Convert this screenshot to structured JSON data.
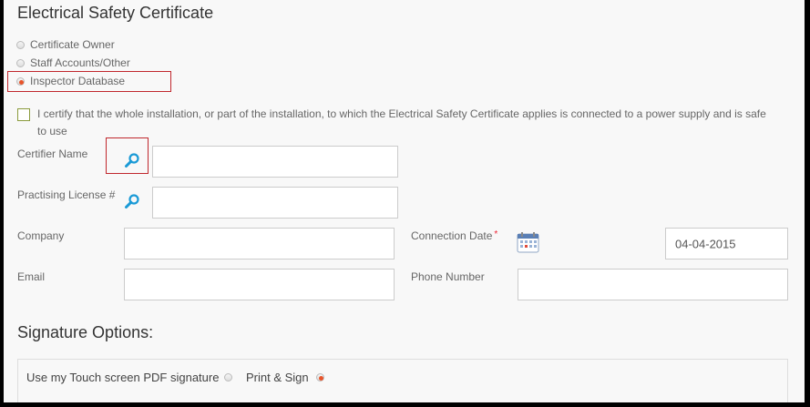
{
  "form": {
    "title": "Electrical Safety Certificate",
    "source_options": [
      {
        "label": "Certificate Owner",
        "selected": false
      },
      {
        "label": "Staff Accounts/Other",
        "selected": false
      },
      {
        "label": "Inspector Database",
        "selected": true
      }
    ],
    "certify_text": "I certify that the whole installation, or part of the installation, to which the Electrical Safety Certificate applies is connected to a power supply and is safe to use",
    "certify_checked": false,
    "fields": {
      "certifier_name": {
        "label": "Certifier Name",
        "value": ""
      },
      "practising_license": {
        "label": "Practising License #",
        "value": ""
      },
      "company": {
        "label": "Company",
        "value": ""
      },
      "connection_date": {
        "label": "Connection Date",
        "required_mark": "*",
        "value": "04-04-2015"
      },
      "email": {
        "label": "Email",
        "value": ""
      },
      "phone_number": {
        "label": "Phone Number",
        "value": ""
      }
    },
    "icons": {
      "search": "search-icon",
      "calendar": "calendar-icon"
    },
    "colors": {
      "highlight_border": "#c0272d",
      "search_icon": "#1a9ad6",
      "radio_selected": "#e8542a",
      "required": "#e22233"
    }
  },
  "signature": {
    "heading": "Signature Options:",
    "options": [
      {
        "label": "Use my Touch screen PDF signature",
        "selected": false
      },
      {
        "label": "Print & Sign",
        "selected": true
      }
    ]
  }
}
